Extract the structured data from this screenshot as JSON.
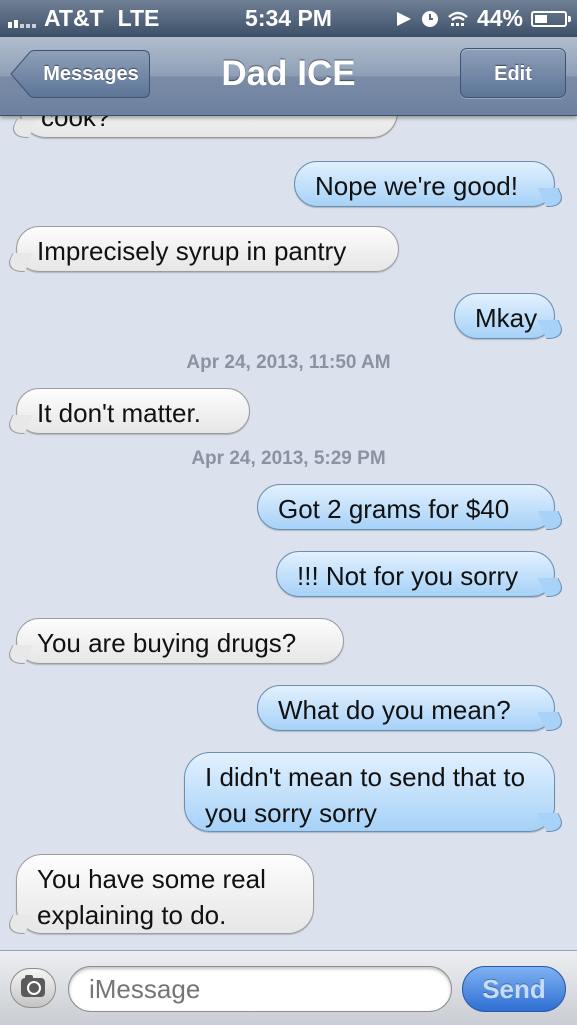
{
  "status_bar": {
    "carrier": "AT&T",
    "network": "LTE",
    "time": "5:34 PM",
    "battery_percent": "44%",
    "battery_level": 0.44,
    "signal_bars_on": 2,
    "signal_bars_total": 5
  },
  "nav": {
    "back_label": "Messages",
    "title": "Dad ICE",
    "edit_label": "Edit"
  },
  "messages": [
    {
      "type": "in",
      "text": "cook?"
    },
    {
      "type": "out",
      "text": "Nope we're good!"
    },
    {
      "type": "in",
      "text": "Imprecisely syrup in pantry"
    },
    {
      "type": "out",
      "text": "Mkay"
    },
    {
      "type": "stamp",
      "text": "Apr 24, 2013, 11:50 AM"
    },
    {
      "type": "in",
      "text": "It don't matter."
    },
    {
      "type": "stamp",
      "text": "Apr 24, 2013, 5:29 PM"
    },
    {
      "type": "out",
      "text": "Got 2 grams for $40"
    },
    {
      "type": "out",
      "text": "!!! Not for you sorry"
    },
    {
      "type": "in",
      "text": "You are buying drugs?"
    },
    {
      "type": "out",
      "text": "What do you mean?"
    },
    {
      "type": "out",
      "text": "I didn't mean to send that to you sorry sorry"
    },
    {
      "type": "in",
      "text": "You have some real explaining to do."
    }
  ],
  "input": {
    "placeholder": "iMessage",
    "value": "",
    "send_label": "Send",
    "camera_icon": "camera-icon"
  },
  "icons": {
    "location": "location-arrow-icon",
    "alarm": "alarm-clock-icon",
    "wifi": "wifi-icon",
    "battery": "battery-icon"
  }
}
